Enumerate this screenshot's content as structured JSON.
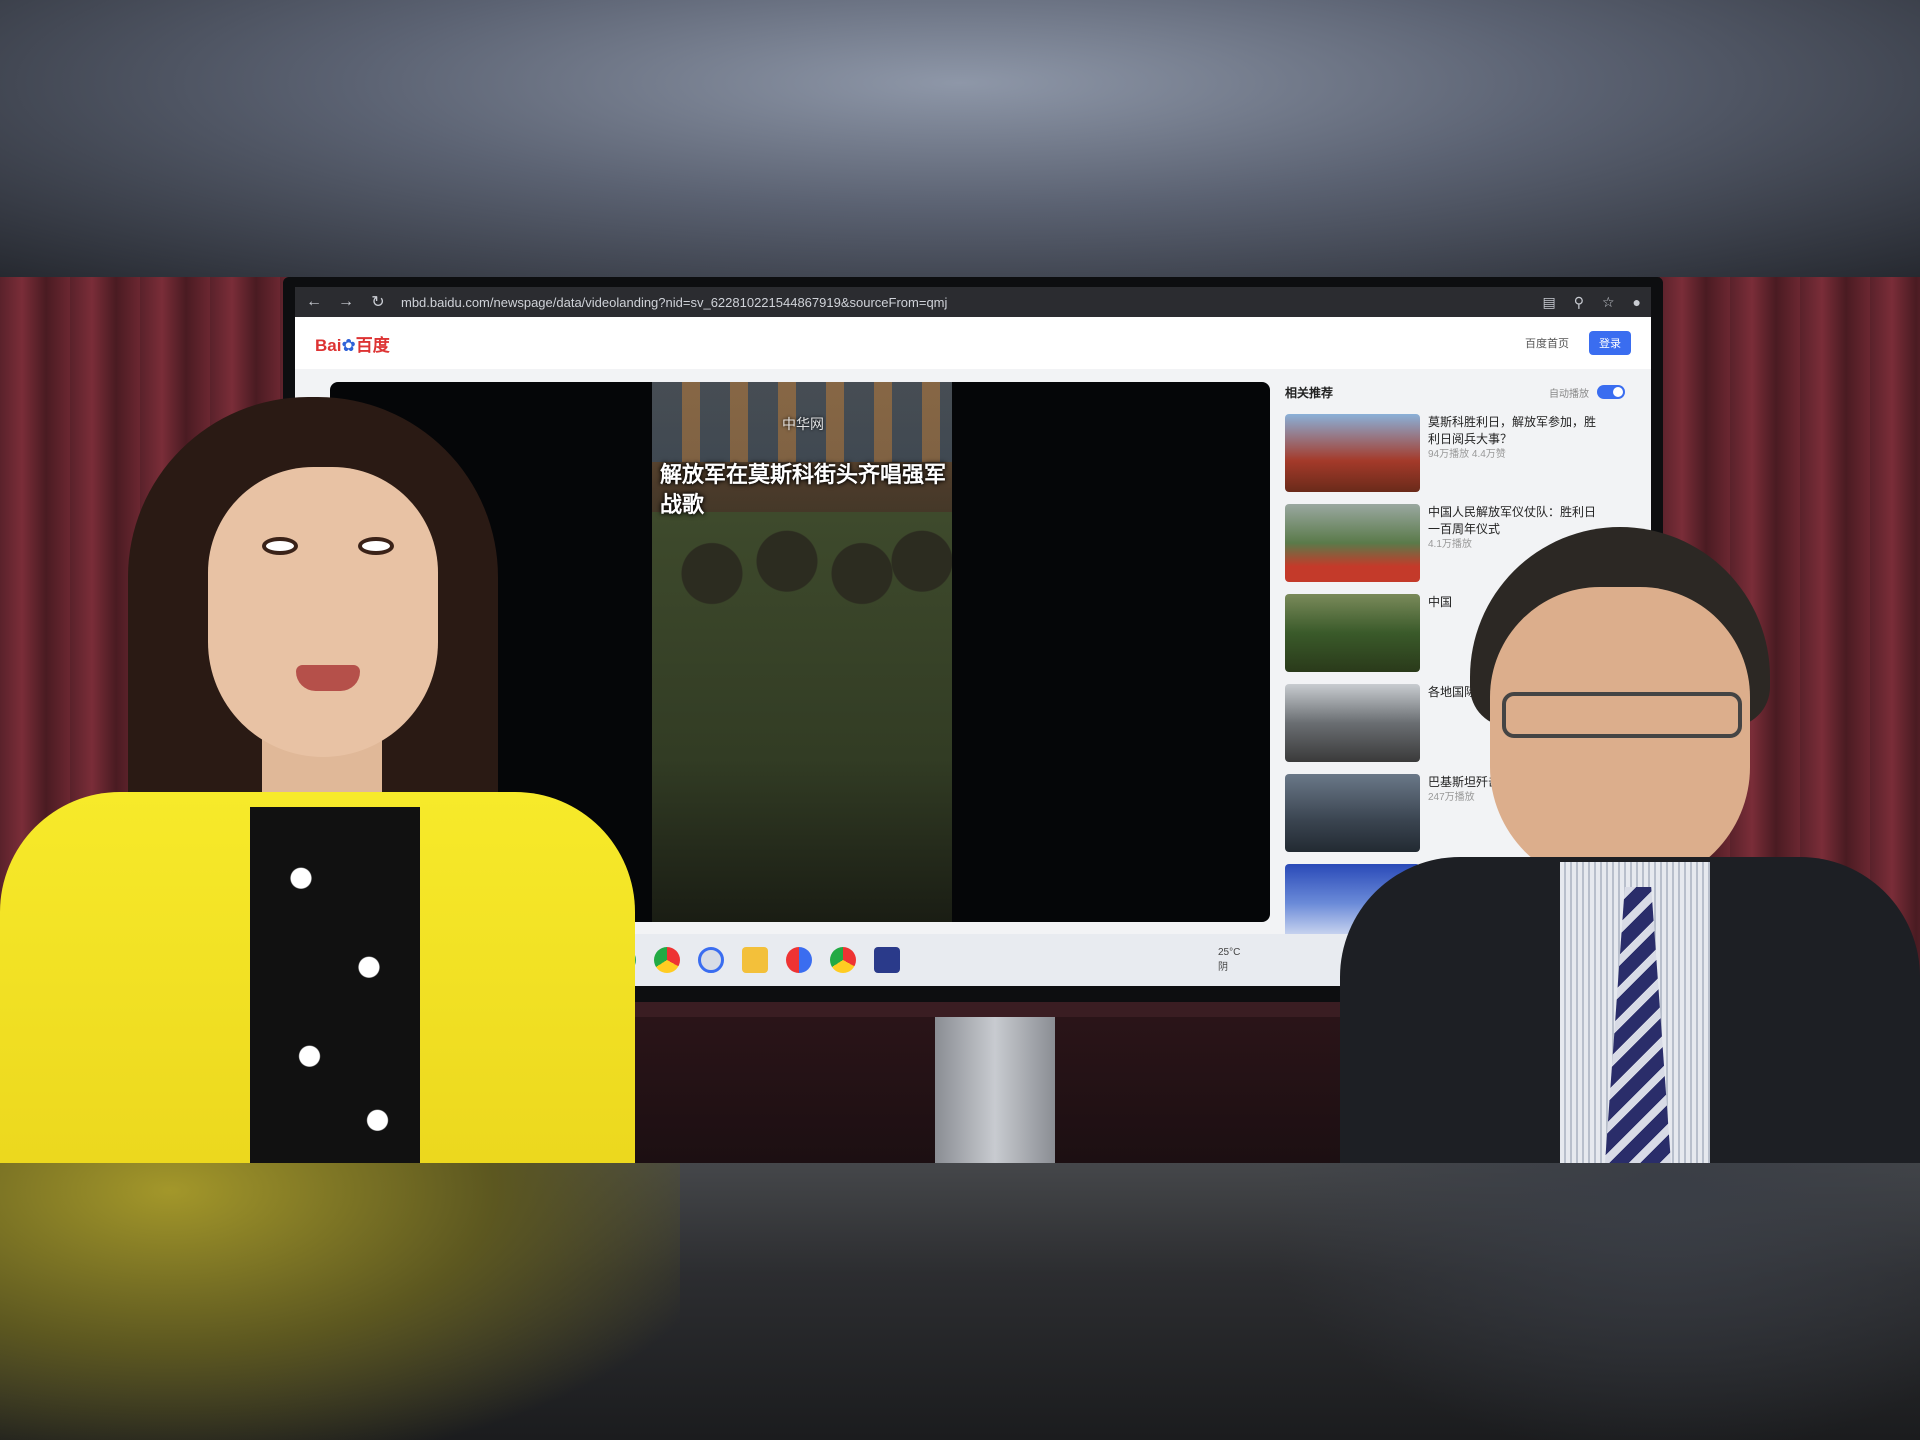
{
  "browser": {
    "url": "mbd.baidu.com/newspage/data/videolanding?nid=sv_622810221544867919&sourceFrom=qmj",
    "nav": {
      "back": "←",
      "forward": "→",
      "reload": "↻"
    }
  },
  "page": {
    "logo_text": "Bai",
    "logo_suffix": "百度",
    "header_link": "百度首页",
    "header_button": "登录"
  },
  "video": {
    "watermark": "中华网",
    "caption": "解放军在莫斯科街头齐唱强军战歌"
  },
  "sidebar": {
    "title": "相关推荐",
    "autoplay_label": "自动播放",
    "items": [
      {
        "title": "莫斯科胜利日，解放军参加，胜利日阅兵大事？",
        "meta": "94万播放 4.4万赞"
      },
      {
        "title": "中国人民解放军仪仗队：胜利日一百周年仪式",
        "meta": "4.1万播放"
      },
      {
        "title": "中国",
        "meta": ""
      },
      {
        "title": "各地国际",
        "meta": ""
      },
      {
        "title": "巴基斯坦歼击机表演",
        "meta": "247万播放"
      },
      {
        "title": "",
        "meta": ""
      }
    ]
  },
  "taskbar": {
    "temperature": "25°C",
    "weather": "阴"
  },
  "colors": {
    "jacket": "#f4e422",
    "curtain": "#6b2731",
    "baidu_blue": "#3a6df0"
  }
}
